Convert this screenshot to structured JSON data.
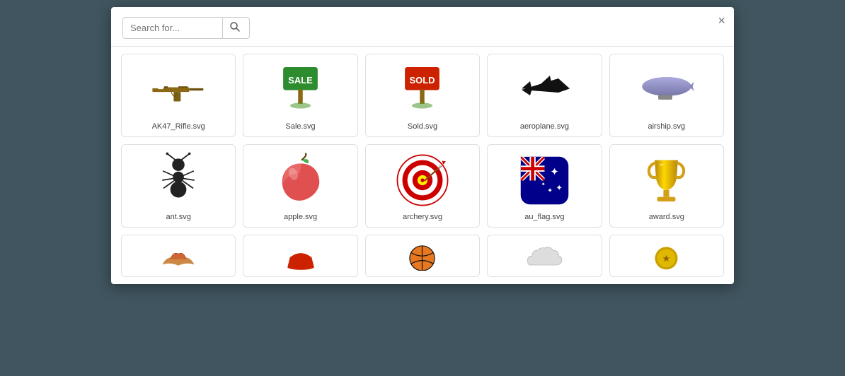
{
  "modal": {
    "search": {
      "placeholder": "Search for...",
      "button_icon": "🔍"
    },
    "close_label": "×",
    "icons": [
      {
        "id": "ak47",
        "label": "AK47_Rifle.svg",
        "type": "ak47"
      },
      {
        "id": "sale",
        "label": "Sale.svg",
        "type": "sale"
      },
      {
        "id": "sold",
        "label": "Sold.svg",
        "type": "sold"
      },
      {
        "id": "aeroplane",
        "label": "aeroplane.svg",
        "type": "aeroplane"
      },
      {
        "id": "airship",
        "label": "airship.svg",
        "type": "airship"
      },
      {
        "id": "ant",
        "label": "ant.svg",
        "type": "ant"
      },
      {
        "id": "apple",
        "label": "apple.svg",
        "type": "apple"
      },
      {
        "id": "archery",
        "label": "archery.svg",
        "type": "archery"
      },
      {
        "id": "au_flag",
        "label": "au_flag.svg",
        "type": "au_flag"
      },
      {
        "id": "award",
        "label": "award.svg",
        "type": "award"
      }
    ],
    "partial_icons": [
      {
        "id": "partial1",
        "label": "",
        "type": "partial1"
      },
      {
        "id": "partial2",
        "label": "",
        "type": "partial2"
      },
      {
        "id": "partial3",
        "label": "",
        "type": "partial3"
      },
      {
        "id": "partial4",
        "label": "",
        "type": "partial4"
      },
      {
        "id": "partial5",
        "label": "",
        "type": "partial5"
      }
    ]
  }
}
